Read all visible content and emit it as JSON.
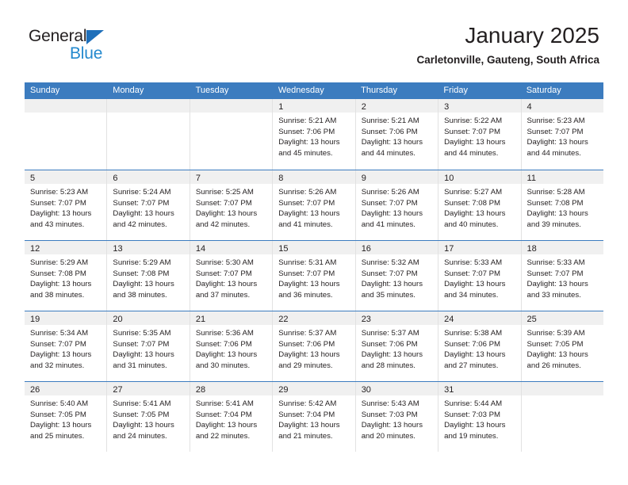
{
  "logo": {
    "primary_text": "General",
    "secondary_text": "Blue",
    "primary_color": "#231f20",
    "secondary_color": "#2489ce",
    "triangle_color": "#1e6fba"
  },
  "header": {
    "month_title": "January 2025",
    "location": "Carletonville, Gauteng, South Africa"
  },
  "calendar": {
    "header_bg_color": "#3c7cbf",
    "header_text_color": "#ffffff",
    "day_band_color": "#f0f0f0",
    "weekdays": [
      "Sunday",
      "Monday",
      "Tuesday",
      "Wednesday",
      "Thursday",
      "Friday",
      "Saturday"
    ],
    "weeks": [
      [
        {
          "day": "",
          "empty": true
        },
        {
          "day": "",
          "empty": true
        },
        {
          "day": "",
          "empty": true
        },
        {
          "day": "1",
          "sunrise": "Sunrise: 5:21 AM",
          "sunset": "Sunset: 7:06 PM",
          "daylight_1": "Daylight: 13 hours",
          "daylight_2": "and 45 minutes."
        },
        {
          "day": "2",
          "sunrise": "Sunrise: 5:21 AM",
          "sunset": "Sunset: 7:06 PM",
          "daylight_1": "Daylight: 13 hours",
          "daylight_2": "and 44 minutes."
        },
        {
          "day": "3",
          "sunrise": "Sunrise: 5:22 AM",
          "sunset": "Sunset: 7:07 PM",
          "daylight_1": "Daylight: 13 hours",
          "daylight_2": "and 44 minutes."
        },
        {
          "day": "4",
          "sunrise": "Sunrise: 5:23 AM",
          "sunset": "Sunset: 7:07 PM",
          "daylight_1": "Daylight: 13 hours",
          "daylight_2": "and 44 minutes."
        }
      ],
      [
        {
          "day": "5",
          "sunrise": "Sunrise: 5:23 AM",
          "sunset": "Sunset: 7:07 PM",
          "daylight_1": "Daylight: 13 hours",
          "daylight_2": "and 43 minutes."
        },
        {
          "day": "6",
          "sunrise": "Sunrise: 5:24 AM",
          "sunset": "Sunset: 7:07 PM",
          "daylight_1": "Daylight: 13 hours",
          "daylight_2": "and 42 minutes."
        },
        {
          "day": "7",
          "sunrise": "Sunrise: 5:25 AM",
          "sunset": "Sunset: 7:07 PM",
          "daylight_1": "Daylight: 13 hours",
          "daylight_2": "and 42 minutes."
        },
        {
          "day": "8",
          "sunrise": "Sunrise: 5:26 AM",
          "sunset": "Sunset: 7:07 PM",
          "daylight_1": "Daylight: 13 hours",
          "daylight_2": "and 41 minutes."
        },
        {
          "day": "9",
          "sunrise": "Sunrise: 5:26 AM",
          "sunset": "Sunset: 7:07 PM",
          "daylight_1": "Daylight: 13 hours",
          "daylight_2": "and 41 minutes."
        },
        {
          "day": "10",
          "sunrise": "Sunrise: 5:27 AM",
          "sunset": "Sunset: 7:08 PM",
          "daylight_1": "Daylight: 13 hours",
          "daylight_2": "and 40 minutes."
        },
        {
          "day": "11",
          "sunrise": "Sunrise: 5:28 AM",
          "sunset": "Sunset: 7:08 PM",
          "daylight_1": "Daylight: 13 hours",
          "daylight_2": "and 39 minutes."
        }
      ],
      [
        {
          "day": "12",
          "sunrise": "Sunrise: 5:29 AM",
          "sunset": "Sunset: 7:08 PM",
          "daylight_1": "Daylight: 13 hours",
          "daylight_2": "and 38 minutes."
        },
        {
          "day": "13",
          "sunrise": "Sunrise: 5:29 AM",
          "sunset": "Sunset: 7:08 PM",
          "daylight_1": "Daylight: 13 hours",
          "daylight_2": "and 38 minutes."
        },
        {
          "day": "14",
          "sunrise": "Sunrise: 5:30 AM",
          "sunset": "Sunset: 7:07 PM",
          "daylight_1": "Daylight: 13 hours",
          "daylight_2": "and 37 minutes."
        },
        {
          "day": "15",
          "sunrise": "Sunrise: 5:31 AM",
          "sunset": "Sunset: 7:07 PM",
          "daylight_1": "Daylight: 13 hours",
          "daylight_2": "and 36 minutes."
        },
        {
          "day": "16",
          "sunrise": "Sunrise: 5:32 AM",
          "sunset": "Sunset: 7:07 PM",
          "daylight_1": "Daylight: 13 hours",
          "daylight_2": "and 35 minutes."
        },
        {
          "day": "17",
          "sunrise": "Sunrise: 5:33 AM",
          "sunset": "Sunset: 7:07 PM",
          "daylight_1": "Daylight: 13 hours",
          "daylight_2": "and 34 minutes."
        },
        {
          "day": "18",
          "sunrise": "Sunrise: 5:33 AM",
          "sunset": "Sunset: 7:07 PM",
          "daylight_1": "Daylight: 13 hours",
          "daylight_2": "and 33 minutes."
        }
      ],
      [
        {
          "day": "19",
          "sunrise": "Sunrise: 5:34 AM",
          "sunset": "Sunset: 7:07 PM",
          "daylight_1": "Daylight: 13 hours",
          "daylight_2": "and 32 minutes."
        },
        {
          "day": "20",
          "sunrise": "Sunrise: 5:35 AM",
          "sunset": "Sunset: 7:07 PM",
          "daylight_1": "Daylight: 13 hours",
          "daylight_2": "and 31 minutes."
        },
        {
          "day": "21",
          "sunrise": "Sunrise: 5:36 AM",
          "sunset": "Sunset: 7:06 PM",
          "daylight_1": "Daylight: 13 hours",
          "daylight_2": "and 30 minutes."
        },
        {
          "day": "22",
          "sunrise": "Sunrise: 5:37 AM",
          "sunset": "Sunset: 7:06 PM",
          "daylight_1": "Daylight: 13 hours",
          "daylight_2": "and 29 minutes."
        },
        {
          "day": "23",
          "sunrise": "Sunrise: 5:37 AM",
          "sunset": "Sunset: 7:06 PM",
          "daylight_1": "Daylight: 13 hours",
          "daylight_2": "and 28 minutes."
        },
        {
          "day": "24",
          "sunrise": "Sunrise: 5:38 AM",
          "sunset": "Sunset: 7:06 PM",
          "daylight_1": "Daylight: 13 hours",
          "daylight_2": "and 27 minutes."
        },
        {
          "day": "25",
          "sunrise": "Sunrise: 5:39 AM",
          "sunset": "Sunset: 7:05 PM",
          "daylight_1": "Daylight: 13 hours",
          "daylight_2": "and 26 minutes."
        }
      ],
      [
        {
          "day": "26",
          "sunrise": "Sunrise: 5:40 AM",
          "sunset": "Sunset: 7:05 PM",
          "daylight_1": "Daylight: 13 hours",
          "daylight_2": "and 25 minutes."
        },
        {
          "day": "27",
          "sunrise": "Sunrise: 5:41 AM",
          "sunset": "Sunset: 7:05 PM",
          "daylight_1": "Daylight: 13 hours",
          "daylight_2": "and 24 minutes."
        },
        {
          "day": "28",
          "sunrise": "Sunrise: 5:41 AM",
          "sunset": "Sunset: 7:04 PM",
          "daylight_1": "Daylight: 13 hours",
          "daylight_2": "and 22 minutes."
        },
        {
          "day": "29",
          "sunrise": "Sunrise: 5:42 AM",
          "sunset": "Sunset: 7:04 PM",
          "daylight_1": "Daylight: 13 hours",
          "daylight_2": "and 21 minutes."
        },
        {
          "day": "30",
          "sunrise": "Sunrise: 5:43 AM",
          "sunset": "Sunset: 7:03 PM",
          "daylight_1": "Daylight: 13 hours",
          "daylight_2": "and 20 minutes."
        },
        {
          "day": "31",
          "sunrise": "Sunrise: 5:44 AM",
          "sunset": "Sunset: 7:03 PM",
          "daylight_1": "Daylight: 13 hours",
          "daylight_2": "and 19 minutes."
        },
        {
          "day": "",
          "empty": true
        }
      ]
    ]
  }
}
